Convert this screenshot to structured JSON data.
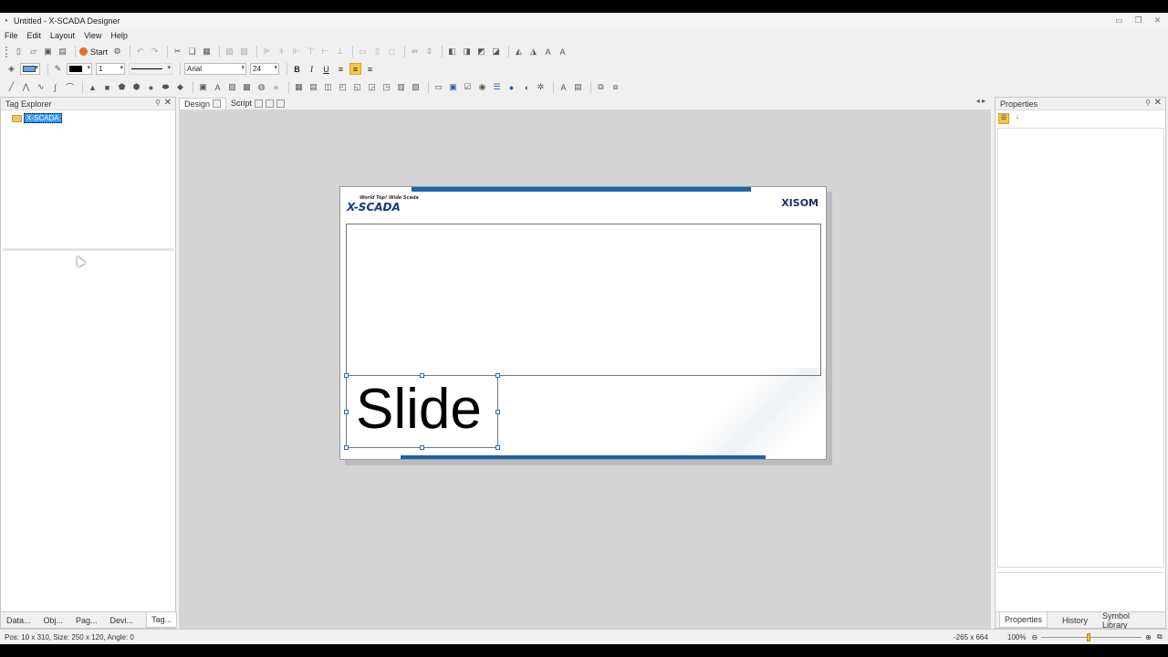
{
  "window": {
    "title": "Untitled - X-SCADA Designer"
  },
  "menu": [
    "File",
    "Edit",
    "Layout",
    "View",
    "Help"
  ],
  "toolbar": {
    "start_label": "Start",
    "line_width": "1",
    "font_name": "Arial",
    "font_size": "24",
    "bold": "B",
    "italic": "I",
    "underline": "U"
  },
  "left_panel": {
    "title": "Tag Explorer",
    "tree_root": "X-SCADA",
    "tabs": [
      "Data...",
      "Obj...",
      "Pag...",
      "Devi...",
      "Tag..."
    ]
  },
  "doc_tabs": [
    "Design",
    "Script"
  ],
  "slide": {
    "logo_left": "X-SCADA",
    "logo_left_tagline": "World Top! Wide Scada",
    "logo_right": "XISOM",
    "selected_text": "Slide"
  },
  "right_panel": {
    "title": "Properties",
    "tabs": [
      "Properties",
      "History",
      "Symbol Library"
    ]
  },
  "status": {
    "selection": "Pos: 10 x 310, Size: 250 x 120, Angle: 0",
    "canvas_size": "-265 x 664",
    "zoom": "100%"
  },
  "colors": {
    "accent": "#1c62ad",
    "selection": "#3399ff",
    "highlight": "#f5c842"
  }
}
